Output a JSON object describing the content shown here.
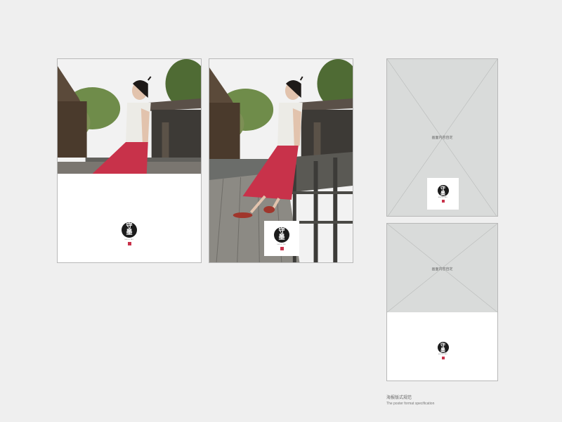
{
  "posters": {
    "poster_1": {
      "logo": {
        "char_top": "守",
        "char_bottom": "墨",
        "sub": "SHOU MO"
      }
    },
    "poster_2": {
      "logo": {
        "char_top": "守",
        "char_bottom": "墨",
        "sub": "SHOU MO"
      }
    }
  },
  "spec": {
    "full": {
      "content_label": "画面内容自定",
      "logo": {
        "char_top": "守",
        "char_bottom": "墨",
        "sub": "SHOU MO"
      }
    },
    "half": {
      "content_label": "画面内容自定",
      "logo": {
        "char_top": "守",
        "char_bottom": "墨",
        "sub": "SHOU MO"
      }
    }
  },
  "caption": {
    "title_zh": "海报版式规范",
    "title_en": "The poster format specification"
  },
  "colors": {
    "background": "#efefef",
    "placeholder_gray": "#d9dbda",
    "skirt_red": "#c8324a",
    "logo_black": "#1b1b1b"
  }
}
